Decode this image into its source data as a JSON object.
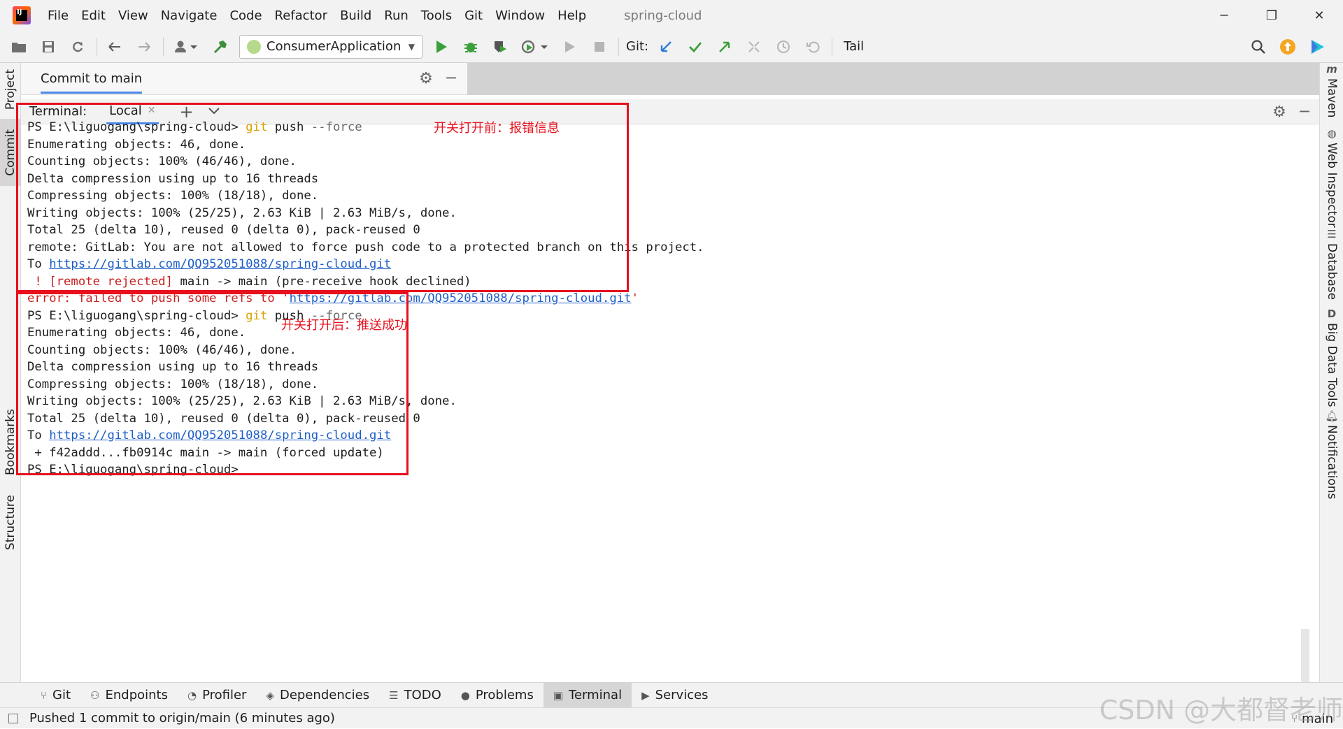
{
  "window": {
    "title": "spring-cloud",
    "menu": [
      "File",
      "Edit",
      "View",
      "Navigate",
      "Code",
      "Refactor",
      "Build",
      "Run",
      "Tools",
      "Git",
      "Window",
      "Help"
    ],
    "controls": {
      "minimize": "─",
      "restore": "❐",
      "close": "✕"
    }
  },
  "toolbar": {
    "run_config": "ConsumerApplication",
    "git_label": "Git:",
    "tail_label": "Tail"
  },
  "left_stripe": {
    "project": "Project",
    "commit": "Commit",
    "bookmarks": "Bookmarks",
    "structure": "Structure"
  },
  "right_stripe": {
    "maven": "Maven",
    "web_inspector": "Web Inspector",
    "database": "Database",
    "big_data_tools": "Big Data Tools",
    "notifications": "Notifications"
  },
  "commit_panel": {
    "tab": "Commit to main"
  },
  "terminal": {
    "label": "Terminal:",
    "tab": "Local",
    "block1": {
      "prompt": "PS E:\\liguogang\\spring-cloud> ",
      "cmd": "git",
      "cmd_rest": " push",
      "arg": " --force",
      "l2": "Enumerating objects: 46, done.",
      "l3": "Counting objects: 100% (46/46), done.",
      "l4": "Delta compression using up to 16 threads",
      "l5": "Compressing objects: 100% (18/18), done.",
      "l6": "Writing objects: 100% (25/25), 2.63 KiB | 2.63 MiB/s, done.",
      "l7": "Total 25 (delta 10), reused 0 (delta 0), pack-reused 0",
      "l8": "remote: GitLab: You are not allowed to force push code to a protected branch on this project.",
      "l9_prefix": "To ",
      "l9_link": "https://gitlab.com/QQ952051088/spring-cloud.git",
      "l10_err": " ! [remote rejected]",
      "l10_rest": " main -> main (pre-receive hook declined)",
      "l11_err": "error: failed to push some refs to '",
      "l11_link": "https://gitlab.com/QQ952051088/spring-cloud.git",
      "l11_end": "'",
      "annotation": "开关打开前：报错信息"
    },
    "block2": {
      "prompt": "PS E:\\liguogang\\spring-cloud> ",
      "cmd": "git",
      "cmd_rest": " push",
      "arg": " --force",
      "l2": "Enumerating objects: 46, done.",
      "l3": "Counting objects: 100% (46/46), done.",
      "l4": "Delta compression using up to 16 threads",
      "l5": "Compressing objects: 100% (18/18), done.",
      "l6": "Writing objects: 100% (25/25), 2.63 KiB | 2.63 MiB/s, done.",
      "l7": "Total 25 (delta 10), reused 0 (delta 0), pack-reused 0",
      "l8_prefix": "To ",
      "l8_link": "https://gitlab.com/QQ952051088/spring-cloud.git",
      "l9": " + f42addd...fb0914c main -> main (forced update)",
      "l10": "PS E:\\liguogang\\spring-cloud>",
      "annotation": "开关打开后：推送成功"
    }
  },
  "tool_tabs": [
    "Git",
    "Endpoints",
    "Profiler",
    "Dependencies",
    "TODO",
    "Problems",
    "Terminal",
    "Services"
  ],
  "status": {
    "message": "Pushed 1 commit to origin/main (6 minutes ago)",
    "branch": "main",
    "watermark": "CSDN @大都督老师"
  }
}
